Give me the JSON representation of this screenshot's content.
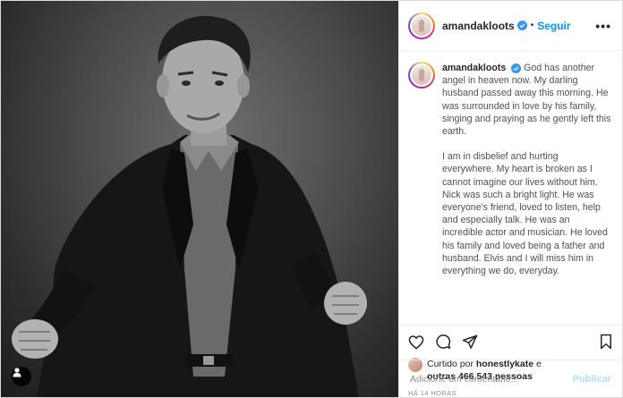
{
  "post": {
    "username": "amandakloots",
    "follow_label": "Seguir",
    "more_label": "•••",
    "caption_paragraphs": [
      "God has another angel in heaven now. My darling husband passed away this morning. He was surrounded in love by his family, singing and praying as he gently left this earth.",
      "I am in disbelief and hurting everywhere. My heart is broken as I cannot imagine our lives without him. Nick was such a bright light. He was everyone's friend, loved to listen, help and especially talk. He was an incredible actor and musician. He loved his family and loved being a father and husband. Elvis and I will miss him in everything we do, everyday."
    ],
    "likes": {
      "prefix": "Curtido por",
      "liker": "honestlykate",
      "connector": "e",
      "others": "outras 466.543 pessoas"
    },
    "timestamp": "HÁ 14 HORAS",
    "comment_placeholder": "Adicione um comentário...",
    "publish_label": "Publicar"
  },
  "icons": {
    "header": [
      "verified-badge"
    ],
    "actions": [
      "heart-icon",
      "comment-icon",
      "share-icon",
      "bookmark-icon"
    ],
    "photo": [
      "user-tag-icon"
    ]
  },
  "colors": {
    "link_blue": "#0095f6",
    "publish_disabled": "#b2dffc",
    "muted": "#8e8e8e",
    "verified": "#3897f0"
  }
}
